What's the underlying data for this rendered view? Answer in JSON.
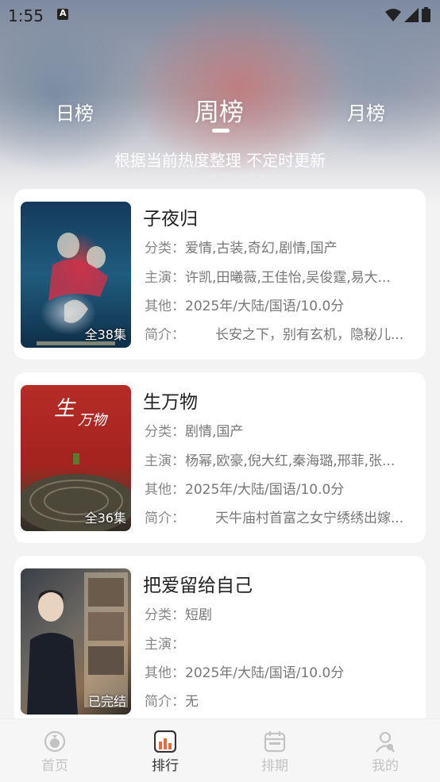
{
  "status": {
    "time": "1:55",
    "notif_letter": "A"
  },
  "tabs": [
    {
      "label": "日榜"
    },
    {
      "label": "周榜"
    },
    {
      "label": "月榜"
    }
  ],
  "subtitle": "根据当前热度整理 不定时更新",
  "items": [
    {
      "title": "子夜归",
      "badge": "全38集",
      "category": "爱情,古装,奇幻,剧情,国产",
      "cast": "许凯,田曦薇,王佳怡,吴俊霆,易大...",
      "other": "2025年/大陆/国语/10.0分",
      "intro": "长安之下，别有玄机，隐秘儿..."
    },
    {
      "title": "生万物",
      "badge": "全36集",
      "category": "剧情,国产",
      "cast": "杨幂,欧豪,倪大红,秦海璐,邢菲,张...",
      "other": "2025年/大陆/国语/10.0分",
      "intro": "天牛庙村首富之女宁绣绣出嫁..."
    },
    {
      "title": "把爱留给自己",
      "badge": "已完结",
      "category": "短剧",
      "cast": "",
      "other": "2025年/大陆/国语/10.0分",
      "intro": "无"
    }
  ],
  "labels": {
    "category": "分类：",
    "cast": "主演：",
    "other": "其他：",
    "intro": "简介："
  },
  "tabbar": [
    {
      "label": "首页",
      "icon": "home-icon"
    },
    {
      "label": "排行",
      "icon": "ranking-icon"
    },
    {
      "label": "排期",
      "icon": "calendar-icon"
    },
    {
      "label": "我的",
      "icon": "profile-icon"
    }
  ],
  "colors": {
    "accent": "#e66a3c",
    "inactive": "#c3c3c3"
  }
}
